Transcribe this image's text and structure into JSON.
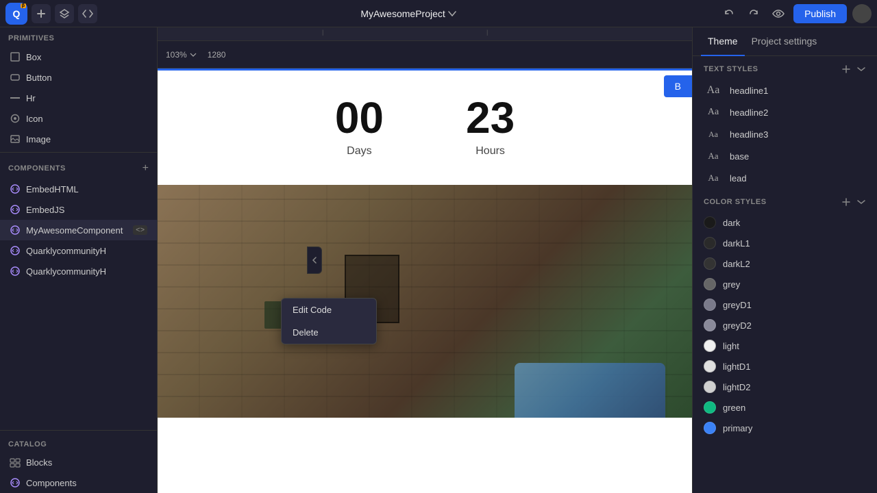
{
  "topbar": {
    "logo_text": "Q",
    "beta_label": "β",
    "project_name": "MyAwesomeProject",
    "publish_label": "Publish",
    "zoom_level": "103%",
    "canvas_width": "1280"
  },
  "left_panel": {
    "primitives_label": "PRIMITIVES",
    "primitives": [
      {
        "id": "box",
        "label": "Box",
        "icon": "□"
      },
      {
        "id": "button",
        "label": "Button",
        "icon": "▭"
      },
      {
        "id": "hr",
        "label": "Hr",
        "icon": "—"
      },
      {
        "id": "icon",
        "label": "Icon",
        "icon": "◎"
      },
      {
        "id": "image",
        "label": "Image",
        "icon": "⊞"
      }
    ],
    "components_label": "COMPONENTS",
    "components": [
      {
        "id": "embed-html",
        "label": "EmbedHTML",
        "has_code": false
      },
      {
        "id": "embed-js",
        "label": "EmbedJS",
        "has_code": false
      },
      {
        "id": "my-awesome-component",
        "label": "MyAwesomeComponent",
        "has_code": true
      },
      {
        "id": "quarkly1",
        "label": "QuarklycommunityH",
        "has_code": false
      },
      {
        "id": "quarkly2",
        "label": "QuarklycommunityH",
        "has_code": false
      }
    ],
    "catalog_label": "CATALOG",
    "catalog_items": [
      {
        "id": "blocks",
        "label": "Blocks",
        "icon": "▦"
      },
      {
        "id": "components-cat",
        "label": "Components",
        "icon": "✦"
      }
    ]
  },
  "context_menu": {
    "items": [
      {
        "id": "edit-code",
        "label": "Edit Code"
      },
      {
        "id": "delete",
        "label": "Delete"
      }
    ]
  },
  "canvas": {
    "countdown": {
      "days_value": "00",
      "days_label": "Days",
      "hours_value": "23",
      "hours_label": "Hours"
    }
  },
  "right_panel": {
    "tabs": [
      {
        "id": "theme",
        "label": "Theme"
      },
      {
        "id": "project-settings",
        "label": "Project settings"
      }
    ],
    "text_styles_label": "TEXT STYLES",
    "text_styles": [
      {
        "id": "headline1",
        "label": "headline1"
      },
      {
        "id": "headline2",
        "label": "headline2"
      },
      {
        "id": "headline3",
        "label": "headline3"
      },
      {
        "id": "base",
        "label": "base"
      },
      {
        "id": "lead",
        "label": "lead"
      }
    ],
    "color_styles_label": "COLOR STYLES",
    "color_styles": [
      {
        "id": "dark",
        "label": "dark",
        "swatch": "dark"
      },
      {
        "id": "darkL1",
        "label": "darkL1",
        "swatch": "darkL1"
      },
      {
        "id": "darkL2",
        "label": "darkL2",
        "swatch": "darkL2"
      },
      {
        "id": "grey",
        "label": "grey",
        "swatch": "grey"
      },
      {
        "id": "greyD1",
        "label": "greyD1",
        "swatch": "greyD1"
      },
      {
        "id": "greyD2",
        "label": "greyD2",
        "swatch": "greyD2"
      },
      {
        "id": "light",
        "label": "light",
        "swatch": "light"
      },
      {
        "id": "lightD1",
        "label": "lightD1",
        "swatch": "lightD1"
      },
      {
        "id": "lightD2",
        "label": "lightD2",
        "swatch": "lightD2"
      },
      {
        "id": "green",
        "label": "green",
        "swatch": "green"
      },
      {
        "id": "primary",
        "label": "primary",
        "swatch": "primary"
      }
    ]
  }
}
